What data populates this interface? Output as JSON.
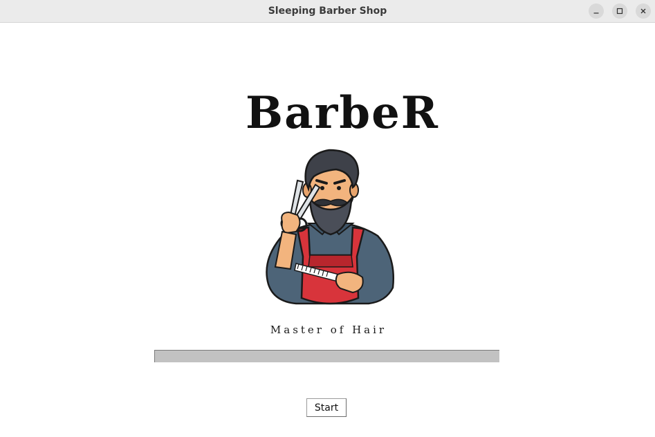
{
  "window": {
    "title": "Sleeping Barber Shop",
    "controls": {
      "minimize": "minimize-icon",
      "maximize": "maximize-icon",
      "close": "close-icon"
    }
  },
  "logo": {
    "title": "BarbeR",
    "tagline": "Master of Hair"
  },
  "progress": {
    "value": 0
  },
  "actions": {
    "start_label": "Start"
  },
  "colors": {
    "apron": "#d8343b",
    "shirt": "#4d6478",
    "hair": "#3e4149",
    "skin": "#f2b47e",
    "progress_track": "#c2c2c2"
  }
}
